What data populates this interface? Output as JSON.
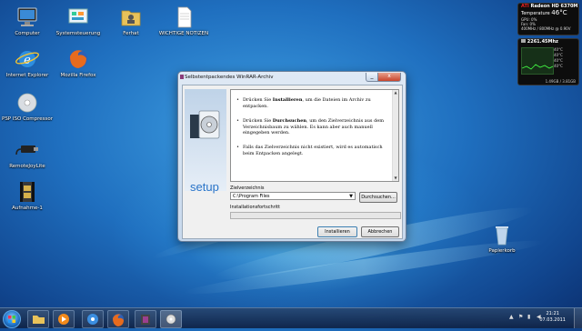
{
  "desktop": {
    "icons": [
      {
        "label": "Computer",
        "icon": "computer-icon"
      },
      {
        "label": "Systemsteuerung",
        "icon": "control-panel-icon"
      },
      {
        "label": "Ferhat",
        "icon": "user-folder-icon"
      },
      {
        "label": "WICHTIGE NOTIZEN",
        "icon": "text-document-icon"
      },
      {
        "label": "Internet Explorer",
        "icon": "internet-explorer-icon"
      },
      {
        "label": "Mozilla Firefox",
        "icon": "firefox-icon"
      },
      {
        "label": "PSP ISO Compressor",
        "icon": "disc-icon"
      },
      {
        "label": "RemoteJoyLite",
        "icon": "usb-cable-icon"
      },
      {
        "label": "Aufnahme-1",
        "icon": "video-file-icon"
      },
      {
        "label": "Papierkorb",
        "icon": "recycle-bin-icon"
      }
    ]
  },
  "gadgets": {
    "gpu": {
      "brand": "ATI",
      "model": "Radeon HD 6370M",
      "label": "Temperature",
      "value": "46°C",
      "rows": [
        "GPU: 0%",
        "Fan: 0%",
        "400MHz / 800MHz @ 0.90V"
      ]
    },
    "cpu": {
      "freq": "2261.45Mhz",
      "cores": [
        "40°C",
        "40°C",
        "40°C",
        "40°C"
      ],
      "bottom": "1.49GB / 3.81GB"
    }
  },
  "dialog": {
    "title": "Selbstentpackendes WinRAR-Archiv",
    "close_symbol": "x",
    "minimize_symbol": "_",
    "setup_text": "setup",
    "paragraphs": [
      {
        "pre": "Drücken Sie ",
        "bold": "Installieren",
        "post": ", um die Dateien im Archiv zu entpacken."
      },
      {
        "pre": "Drücken Sie ",
        "bold": "Durchsuchen",
        "post": ", um den Zielverzeichnis aus dem Verzeichnisbaum zu wählen. Es kann aber auch manuell eingegeben werden."
      },
      {
        "pre": "",
        "bold": "",
        "post": "Falls das Zielverzeichnis nicht existiert, wird es automatisch beim Entpacken angelegt."
      }
    ],
    "dest_label": "Zielverzeichnis",
    "dest_value": "C:\\Program Files",
    "browse_label": "Durchsuchen...",
    "progress_label": "Installationsfortschritt",
    "progress": 0,
    "install_label": "Installieren",
    "cancel_label": "Abbrechen"
  },
  "taskbar": {
    "items": [
      "folder-icon",
      "media-player-icon",
      "network-icon",
      "firefox-icon",
      "winrar-icon",
      "disc-tool-icon",
      "disc-tool-icon-2"
    ],
    "time": "21:21",
    "date": "07.03.2011"
  },
  "colors": {
    "accent": "#2a74c8",
    "progress": "#06b025",
    "close": "#c8442c"
  }
}
